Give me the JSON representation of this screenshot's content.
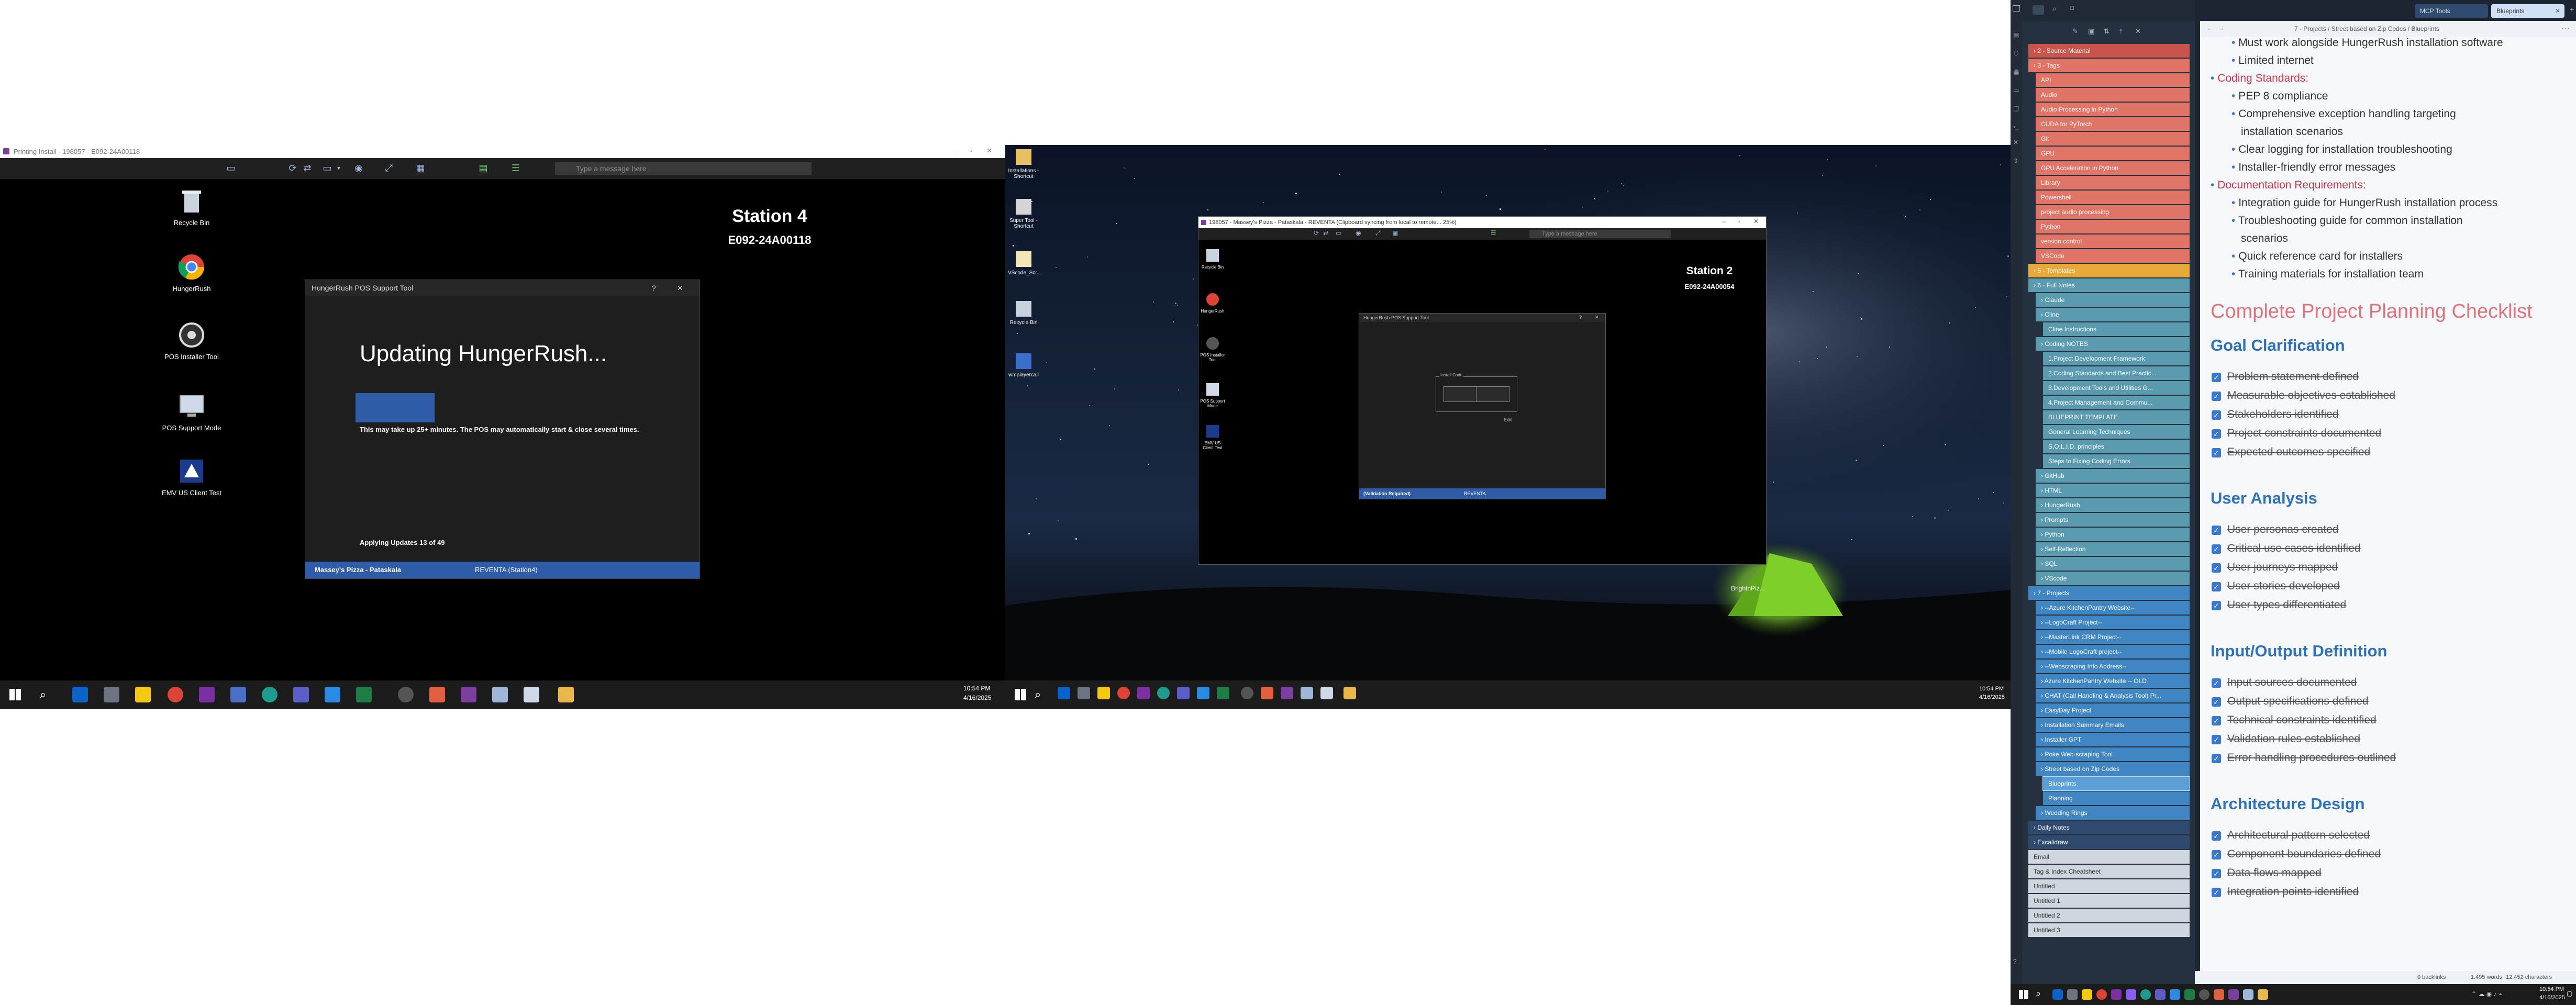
{
  "remote1": {
    "window_title": "Printing Install - 198057 - E092-24A00118",
    "message_placeholder": "Type a message here",
    "station_name": "Station 4",
    "station_id": "E092-24A00118",
    "desktop_icons": [
      "Recycle Bin",
      "HungerRush",
      "POS Installer Tool",
      "POS Support Mode",
      "EMV US Client Test"
    ],
    "tool": {
      "title": "HungerRush POS Support Tool",
      "help": "?",
      "close": "✕",
      "heading": "Updating HungerRush...",
      "warning": "This may take up 25+ minutes. The POS may automatically start & close several times.",
      "progress_text": "Applying Updates 13 of 49",
      "progress": 0.27,
      "footer_left": "Massey's Pizza - Pataskala",
      "footer_right": "REVENTA (Station4)"
    },
    "clock_time": "10:54 PM",
    "clock_date": "4/16/2025"
  },
  "remote2": {
    "window_title": "198057 - Massey's Pizza - Pataskala - REVENTA (Clipboard syncing from local to remote... 25%)",
    "message_placeholder": "Type a message here",
    "station_name": "Station 2",
    "station_id": "E092-24A00054",
    "outer_icons": [
      "Installations - Shortcut",
      "Super Tool - Shortcut",
      "VScode_Scr...",
      "Recycle Bin",
      "wmplayercall"
    ],
    "inner_icons": [
      "Recycle Bin",
      "HungerRush",
      "POS Installer Tool",
      "POS Support Mode",
      "EMV US Client Test"
    ],
    "tool": {
      "title": "HungerRush POS Support Tool",
      "install_code_label": "Install Code",
      "button": "Edit",
      "footer_left": "(Validation Required)",
      "footer_right": "REVENTA"
    },
    "tent_label": "BrightnPiz...",
    "clock_time": "10:54 PM",
    "clock_date": "4/16/2025"
  },
  "sidebar": {
    "tabs": [
      "MCP Tools",
      "Blueprints"
    ],
    "breadcrumb": "7 - Projects / Street based on Zip Codes / Blueprints",
    "tree": [
      {
        "label": "2 - Source Material",
        "color": "#c9544b",
        "indent": 0,
        "folder": true
      },
      {
        "label": "3 - Tags",
        "color": "#e07466",
        "indent": 0,
        "folder": true
      },
      {
        "label": "API",
        "color": "#e07466",
        "indent": 1
      },
      {
        "label": "Audio",
        "color": "#e07466",
        "indent": 1
      },
      {
        "label": "Audio Processing in Python",
        "color": "#e07466",
        "indent": 1
      },
      {
        "label": "CUDA for PyTorch",
        "color": "#e07466",
        "indent": 1
      },
      {
        "label": "Git",
        "color": "#e07466",
        "indent": 1
      },
      {
        "label": "GPU",
        "color": "#e07466",
        "indent": 1
      },
      {
        "label": "GPU Acceleration in Python",
        "color": "#e07466",
        "indent": 1
      },
      {
        "label": "Library",
        "color": "#e07466",
        "indent": 1
      },
      {
        "label": "Powershell",
        "color": "#e07466",
        "indent": 1
      },
      {
        "label": "project audio processing",
        "color": "#e07466",
        "indent": 1
      },
      {
        "label": "Python",
        "color": "#e07466",
        "indent": 1
      },
      {
        "label": "version control",
        "color": "#e07466",
        "indent": 1
      },
      {
        "label": "VSCode",
        "color": "#e07466",
        "indent": 1
      },
      {
        "label": "5 - Templates",
        "color": "#e8a93b",
        "indent": 0,
        "folder": true
      },
      {
        "label": "6 - Full Notes",
        "color": "#5b9bb0",
        "indent": 0,
        "folder": true
      },
      {
        "label": "Claude",
        "color": "#5b9bb0",
        "indent": 1,
        "folder": true
      },
      {
        "label": "Cline",
        "color": "#5b9bb0",
        "indent": 1,
        "folder": true
      },
      {
        "label": "Cline Instructions",
        "color": "#5b9bb0",
        "indent": 2
      },
      {
        "label": "Coding NOTES",
        "color": "#5b9bb0",
        "indent": 1,
        "folder": true
      },
      {
        "label": "1.Project Development Framework",
        "color": "#5b9bb0",
        "indent": 2
      },
      {
        "label": "2.Coding Standards and Best Practic...",
        "color": "#5b9bb0",
        "indent": 2
      },
      {
        "label": "3.Development Tools and Utilities G...",
        "color": "#5b9bb0",
        "indent": 2
      },
      {
        "label": "4.Project Management and Commu...",
        "color": "#5b9bb0",
        "indent": 2
      },
      {
        "label": "BLUEPRINT TEMPLATE",
        "color": "#5b9bb0",
        "indent": 2
      },
      {
        "label": "General Learning Techniques",
        "color": "#5b9bb0",
        "indent": 2
      },
      {
        "label": "S.O.L.I.D. principles",
        "color": "#5b9bb0",
        "indent": 2
      },
      {
        "label": "Steps to Fixing Coding Errors",
        "color": "#5b9bb0",
        "indent": 2
      },
      {
        "label": "GitHub",
        "color": "#5b9bb0",
        "indent": 1,
        "folder": true
      },
      {
        "label": "HTML",
        "color": "#5b9bb0",
        "indent": 1,
        "folder": true
      },
      {
        "label": "HungerRush",
        "color": "#5b9bb0",
        "indent": 1,
        "folder": true
      },
      {
        "label": "Prompts",
        "color": "#5b9bb0",
        "indent": 1,
        "folder": true
      },
      {
        "label": "Python",
        "color": "#5b9bb0",
        "indent": 1,
        "folder": true
      },
      {
        "label": "Self-Reflection",
        "color": "#5b9bb0",
        "indent": 1,
        "folder": true
      },
      {
        "label": "SQL",
        "color": "#5b9bb0",
        "indent": 1,
        "folder": true
      },
      {
        "label": "VScode",
        "color": "#5b9bb0",
        "indent": 1,
        "folder": true
      },
      {
        "label": "7 - Projects",
        "color": "#3f86c2",
        "indent": 0,
        "folder": true
      },
      {
        "label": "--Azure KitchenPantry Website--",
        "color": "#3f86c2",
        "indent": 1,
        "folder": true
      },
      {
        "label": "--LogoCraft Project--",
        "color": "#3f86c2",
        "indent": 1,
        "folder": true
      },
      {
        "label": "--MasterLink CRM Project--",
        "color": "#3f86c2",
        "indent": 1,
        "folder": true
      },
      {
        "label": "--Mobile LogoCraft project--",
        "color": "#3f86c2",
        "indent": 1,
        "folder": true
      },
      {
        "label": "--Webscraping Info Address--",
        "color": "#3f86c2",
        "indent": 1,
        "folder": true
      },
      {
        "label": "Azure KitchenPantry Website -- OLD",
        "color": "#3f86c2",
        "indent": 1,
        "folder": true
      },
      {
        "label": "CHAT (Call Handling & Analysis Tool) Pr...",
        "color": "#3f86c2",
        "indent": 1,
        "folder": true
      },
      {
        "label": "EasyDay Project",
        "color": "#3f86c2",
        "indent": 1,
        "folder": true
      },
      {
        "label": "Installation Summary Emails",
        "color": "#3f86c2",
        "indent": 1,
        "folder": true
      },
      {
        "label": "Installer GPT",
        "color": "#3f86c2",
        "indent": 1,
        "folder": true
      },
      {
        "label": "Poke Web-scraping Tool",
        "color": "#3f86c2",
        "indent": 1,
        "folder": true
      },
      {
        "label": "Street based on Zip Codes",
        "color": "#3f86c2",
        "indent": 1,
        "folder": true
      },
      {
        "label": "Blueprints",
        "color": "#5a9ed6",
        "indent": 2,
        "active": true
      },
      {
        "label": "Planning",
        "color": "#3f86c2",
        "indent": 2
      },
      {
        "label": "Wedding Rings",
        "color": "#3f86c2",
        "indent": 1,
        "folder": true
      },
      {
        "label": "Daily Notes",
        "color": "#2f4a6e",
        "indent": 0,
        "folder": true
      },
      {
        "label": "Excalidraw",
        "color": "#2f4a6e",
        "indent": 0,
        "folder": true
      },
      {
        "label": "Email",
        "color": "#cfd6de",
        "indent": 0
      },
      {
        "label": "Tag & Index Cheatsheet",
        "color": "#cfd6de",
        "indent": 0
      },
      {
        "label": "Untitled",
        "color": "#cfd6de",
        "indent": 0
      },
      {
        "label": "Untitled 1",
        "color": "#cfd6de",
        "indent": 0
      },
      {
        "label": "Untitled 2",
        "color": "#cfd6de",
        "indent": 0
      },
      {
        "label": "Untitled 3",
        "color": "#cfd6de",
        "indent": 0
      }
    ],
    "note_top": [
      {
        "text": "Must work alongside HungerRush installation software",
        "level": 2
      },
      {
        "text": "Limited internet",
        "level": 2
      },
      {
        "text": "Coding Standards:",
        "level": 1,
        "red": true
      },
      {
        "text": "PEP 8 compliance",
        "level": 2
      },
      {
        "text": "Comprehensive exception handling targeting",
        "level": 2
      },
      {
        "text": "installation scenarios",
        "level": 3
      },
      {
        "text": "Clear logging for installation troubleshooting",
        "level": 2
      },
      {
        "text": "Installer-friendly error messages",
        "level": 2
      },
      {
        "text": "Documentation Requirements:",
        "level": 1,
        "red": true
      },
      {
        "text": "Integration guide for HungerRush installation process",
        "level": 2
      },
      {
        "text": "Troubleshooting guide for common installation",
        "level": 2
      },
      {
        "text": "scenarios",
        "level": 3
      },
      {
        "text": "Quick reference card for installers",
        "level": 2
      },
      {
        "text": "Training materials for installation team",
        "level": 2
      }
    ],
    "checklist_title": "Complete Project Planning Checklist",
    "sections": [
      {
        "title": "Goal Clarification",
        "items": [
          "Problem statement defined",
          "Measurable objectives established",
          "Stakeholders identified",
          "Project constraints documented",
          "Expected outcomes specified"
        ]
      },
      {
        "title": "User Analysis",
        "items": [
          "User personas created",
          "Critical use cases identified",
          "User journeys mapped",
          "User stories developed",
          "User types differentiated"
        ]
      },
      {
        "title": "Input/Output Definition",
        "items": [
          "Input sources documented",
          "Output specifications defined",
          "Technical constraints identified",
          "Validation rules established",
          "Error handling procedures outlined"
        ]
      },
      {
        "title": "Architecture Design",
        "items": [
          "Architectural pattern selected",
          "Component boundaries defined",
          "Data flows mapped",
          "Integration points identified"
        ]
      }
    ],
    "status": {
      "backlinks": "0 backlinks",
      "words": "1,495 words",
      "chars": "12,452 characters"
    },
    "clock_time": "10:54 PM",
    "clock_date": "4/16/2025"
  }
}
